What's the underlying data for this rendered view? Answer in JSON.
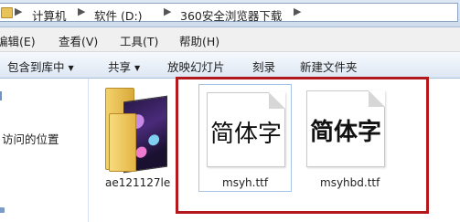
{
  "address_bar": {
    "crumbs": [
      "计算机",
      "软件 (D:)",
      "360安全浏览器下载"
    ]
  },
  "menu": {
    "items": [
      "编辑(E)",
      "查看(V)",
      "工具(T)",
      "帮助(H)"
    ]
  },
  "toolbar": {
    "include_in_library": "包含到库中",
    "share": "共享",
    "slideshow": "放映幻灯片",
    "burn": "刻录",
    "new_folder": "新建文件夹"
  },
  "nav": {
    "recent_places": "访问的位置"
  },
  "files": [
    {
      "name": "ae121127le",
      "type": "folder"
    },
    {
      "name": "msyh.ttf",
      "preview": "简体字",
      "selected": true
    },
    {
      "name": "msyhbd.ttf",
      "preview": "简体字",
      "bold": true
    }
  ],
  "colors": {
    "highlight_border": "#b3181c",
    "selection_border": "#a8c4e4"
  }
}
